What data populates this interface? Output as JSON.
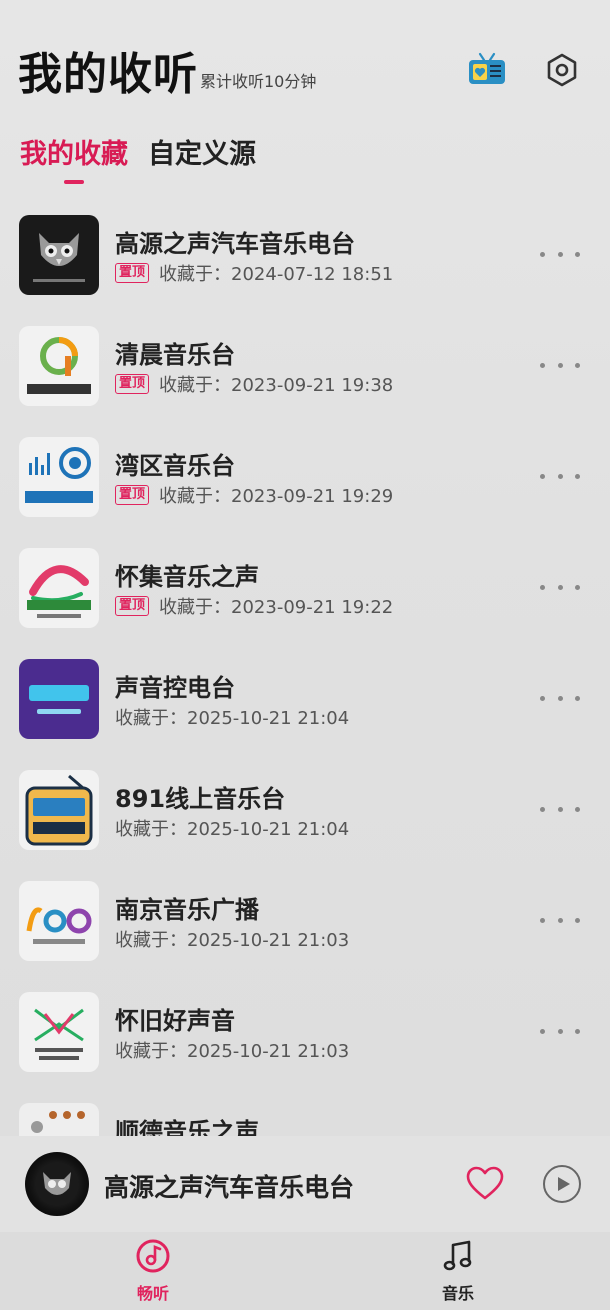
{
  "header": {
    "title": "我的收听",
    "subtitle": "累计收听10分钟",
    "radio_icon": "radio-favorite-icon",
    "settings_icon": "settings-hexagon-icon"
  },
  "tabs": [
    {
      "label": "我的收藏",
      "active": true
    },
    {
      "label": "自定义源",
      "active": false
    }
  ],
  "colors": {
    "accent": "#e0245e",
    "radio_icon": "#2a8fc4"
  },
  "favorites": [
    {
      "title": "高源之声汽车音乐电台",
      "pinned": true,
      "pin_label": "置顶",
      "saved_label": "收藏于：2024-07-12 18:51",
      "logo": "owl-logo"
    },
    {
      "title": "清晨音乐台",
      "pinned": true,
      "pin_label": "置顶",
      "saved_label": "收藏于：2023-09-21 19:38",
      "logo": "qingchen-logo"
    },
    {
      "title": "湾区音乐台",
      "pinned": true,
      "pin_label": "置顶",
      "saved_label": "收藏于：2023-09-21 19:29",
      "logo": "wanqu-logo"
    },
    {
      "title": "怀集音乐之声",
      "pinned": true,
      "pin_label": "置顶",
      "saved_label": "收藏于：2023-09-21 19:22",
      "logo": "huaiji-logo"
    },
    {
      "title": "声音控电台",
      "pinned": false,
      "pin_label": "",
      "saved_label": "收藏于：2025-10-21 21:04",
      "logo": "voicecon-logo"
    },
    {
      "title": "891线上音乐台",
      "pinned": false,
      "pin_label": "",
      "saved_label": "收藏于：2025-10-21 21:04",
      "logo": "fm891-logo"
    },
    {
      "title": "南京音乐广播",
      "pinned": false,
      "pin_label": "",
      "saved_label": "收藏于：2025-10-21 21:03",
      "logo": "nanjing-logo"
    },
    {
      "title": "怀旧好声音",
      "pinned": false,
      "pin_label": "",
      "saved_label": "收藏于：2025-10-21 21:03",
      "logo": "huaijiu-logo"
    },
    {
      "title": "顺德音乐之声",
      "pinned": false,
      "pin_label": "",
      "saved_label": "",
      "logo": "shunde-logo"
    }
  ],
  "player": {
    "now_playing": "高源之声汽车音乐电台",
    "heart_icon": "heart-outline-icon",
    "play_icon": "play-circle-icon"
  },
  "bottom_nav": [
    {
      "label": "畅听",
      "icon": "music-disc-icon",
      "active": true
    },
    {
      "label": "音乐",
      "icon": "music-note-icon",
      "active": false
    }
  ]
}
